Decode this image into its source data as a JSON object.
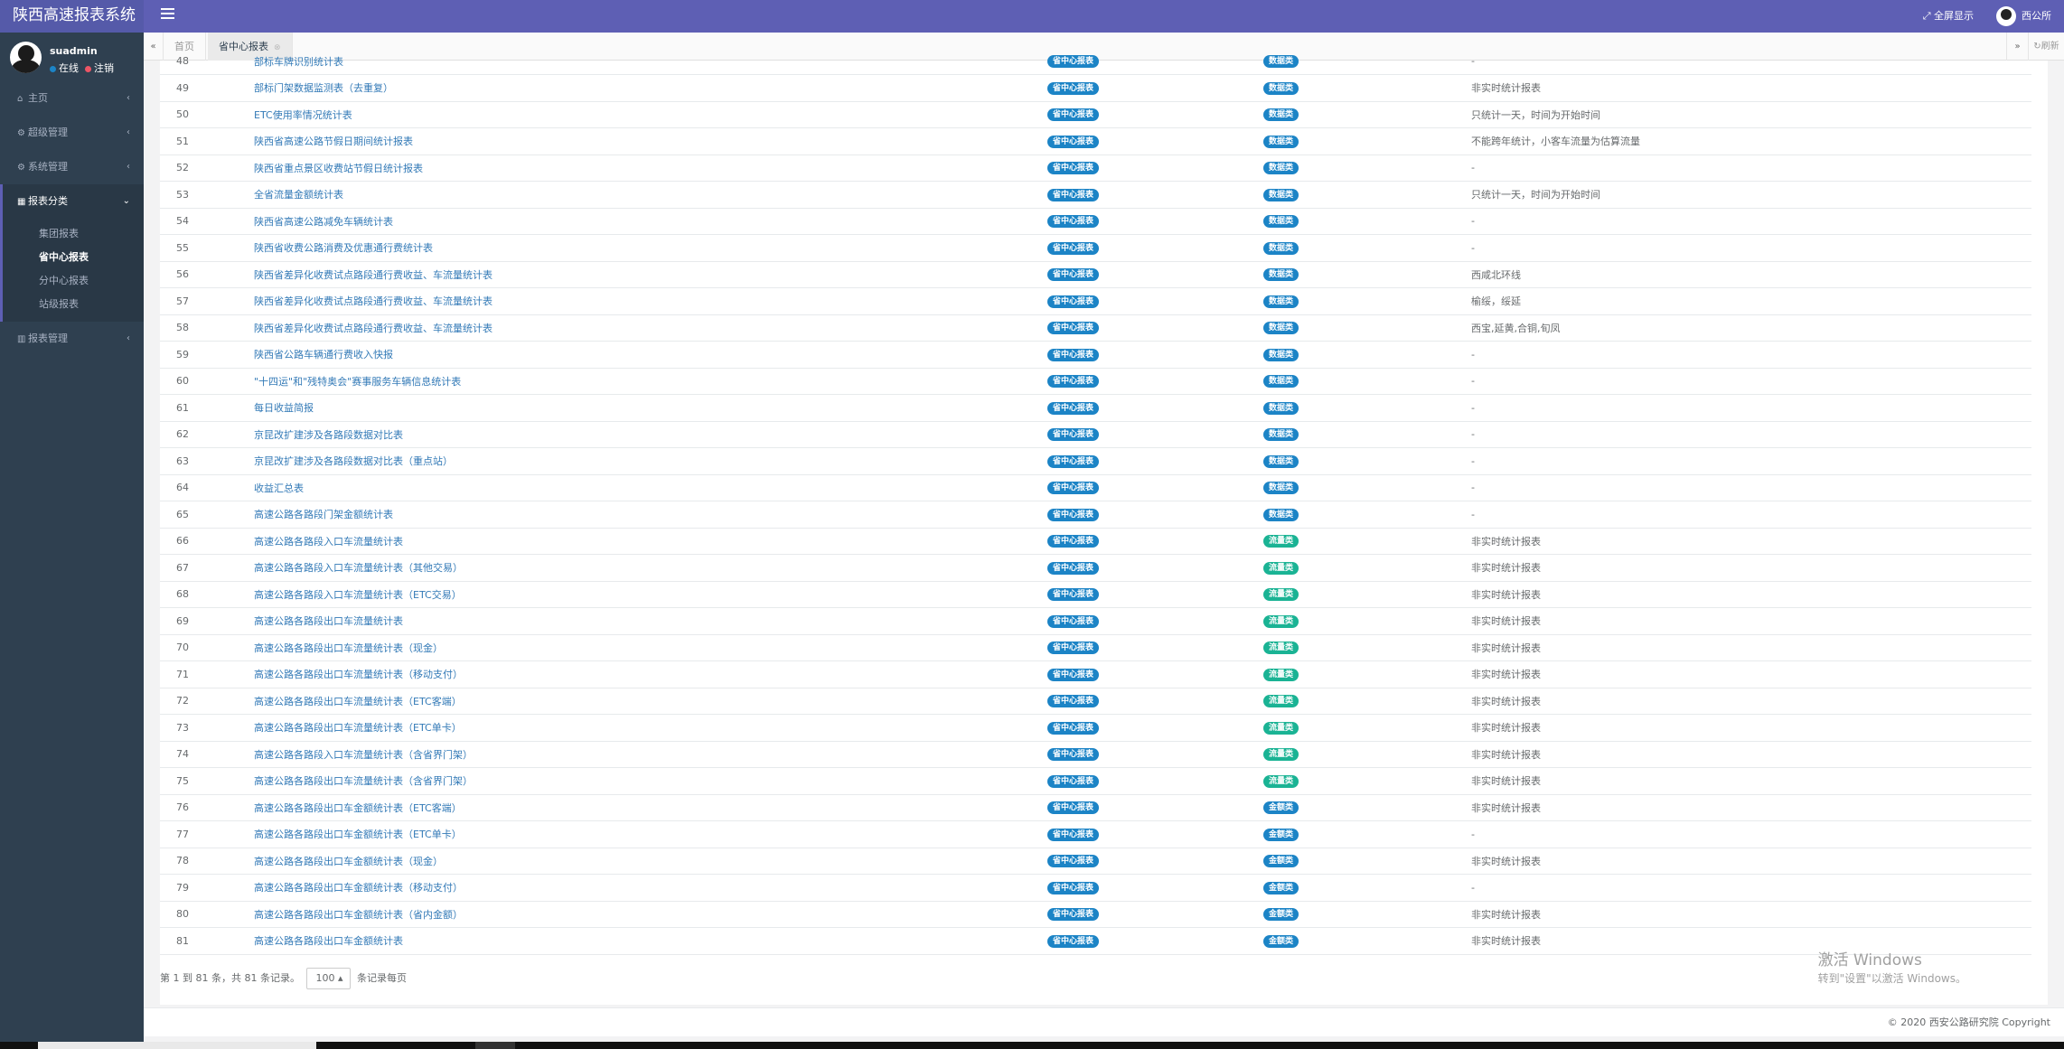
{
  "app": {
    "title": "陕西高速报表系统",
    "fullscreen_label": "全屏显示",
    "user_name": "西公所"
  },
  "sidebar": {
    "username": "suadmin",
    "status_online": "在线",
    "status_logout": "注销",
    "items": [
      {
        "icon": "home-icon",
        "label": "主页"
      },
      {
        "icon": "gear-icon",
        "label": "超级管理"
      },
      {
        "icon": "gear-icon",
        "label": "系统管理"
      },
      {
        "icon": "calendar-icon",
        "label": "报表分类"
      },
      {
        "icon": "bar-chart-icon",
        "label": "报表管理"
      }
    ],
    "submenu": [
      "集团报表",
      "省中心报表",
      "分中心报表",
      "站级报表"
    ]
  },
  "tabs": {
    "home": "首页",
    "active": "省中心报表",
    "refresh": "刷新"
  },
  "colors": {
    "top_bar": "#5e5fb4",
    "badge_blue": "#1c84c6",
    "badge_green": "#1ab394"
  },
  "table": {
    "rows": [
      {
        "no": "48",
        "name": "部标车牌识别统计表",
        "src": "省中心报表",
        "cat": "数据类",
        "note": "-"
      },
      {
        "no": "49",
        "name": "部标门架数据监测表（去重复）",
        "src": "省中心报表",
        "cat": "数据类",
        "note": "非实时统计报表"
      },
      {
        "no": "50",
        "name": "ETC使用率情况统计表",
        "src": "省中心报表",
        "cat": "数据类",
        "note": "只统计一天，时间为开始时间"
      },
      {
        "no": "51",
        "name": "陕西省高速公路节假日期间统计报表",
        "src": "省中心报表",
        "cat": "数据类",
        "note": "不能跨年统计，小客车流量为估算流量"
      },
      {
        "no": "52",
        "name": "陕西省重点景区收费站节假日统计报表",
        "src": "省中心报表",
        "cat": "数据类",
        "note": "-"
      },
      {
        "no": "53",
        "name": "全省流量金额统计表",
        "src": "省中心报表",
        "cat": "数据类",
        "note": "只统计一天，时间为开始时间"
      },
      {
        "no": "54",
        "name": "陕西省高速公路减免车辆统计表",
        "src": "省中心报表",
        "cat": "数据类",
        "note": "-"
      },
      {
        "no": "55",
        "name": "陕西省收费公路消费及优惠通行费统计表",
        "src": "省中心报表",
        "cat": "数据类",
        "note": "-"
      },
      {
        "no": "56",
        "name": "陕西省差异化收费试点路段通行费收益、车流量统计表",
        "src": "省中心报表",
        "cat": "数据类",
        "note": "西咸北环线"
      },
      {
        "no": "57",
        "name": "陕西省差异化收费试点路段通行费收益、车流量统计表",
        "src": "省中心报表",
        "cat": "数据类",
        "note": "榆绥，绥延"
      },
      {
        "no": "58",
        "name": "陕西省差异化收费试点路段通行费收益、车流量统计表",
        "src": "省中心报表",
        "cat": "数据类",
        "note": "西宝,延黄,合铜,旬凤"
      },
      {
        "no": "59",
        "name": "陕西省公路车辆通行费收入快报",
        "src": "省中心报表",
        "cat": "数据类",
        "note": "-"
      },
      {
        "no": "60",
        "name": "\"十四运\"和\"残特奥会\"赛事服务车辆信息统计表",
        "src": "省中心报表",
        "cat": "数据类",
        "note": "-"
      },
      {
        "no": "61",
        "name": "每日收益简报",
        "src": "省中心报表",
        "cat": "数据类",
        "note": "-"
      },
      {
        "no": "62",
        "name": "京昆改扩建涉及各路段数据对比表",
        "src": "省中心报表",
        "cat": "数据类",
        "note": "-"
      },
      {
        "no": "63",
        "name": "京昆改扩建涉及各路段数据对比表（重点站）",
        "src": "省中心报表",
        "cat": "数据类",
        "note": "-"
      },
      {
        "no": "64",
        "name": "收益汇总表",
        "src": "省中心报表",
        "cat": "数据类",
        "note": "-"
      },
      {
        "no": "65",
        "name": "高速公路各路段门架金额统计表",
        "src": "省中心报表",
        "cat": "数据类",
        "note": "-"
      },
      {
        "no": "66",
        "name": "高速公路各路段入口车流量统计表",
        "src": "省中心报表",
        "cat": "流量类",
        "note": "非实时统计报表"
      },
      {
        "no": "67",
        "name": "高速公路各路段入口车流量统计表（其他交易）",
        "src": "省中心报表",
        "cat": "流量类",
        "note": "非实时统计报表"
      },
      {
        "no": "68",
        "name": "高速公路各路段入口车流量统计表（ETC交易）",
        "src": "省中心报表",
        "cat": "流量类",
        "note": "非实时统计报表"
      },
      {
        "no": "69",
        "name": "高速公路各路段出口车流量统计表",
        "src": "省中心报表",
        "cat": "流量类",
        "note": "非实时统计报表"
      },
      {
        "no": "70",
        "name": "高速公路各路段出口车流量统计表（现金）",
        "src": "省中心报表",
        "cat": "流量类",
        "note": "非实时统计报表"
      },
      {
        "no": "71",
        "name": "高速公路各路段出口车流量统计表（移动支付）",
        "src": "省中心报表",
        "cat": "流量类",
        "note": "非实时统计报表"
      },
      {
        "no": "72",
        "name": "高速公路各路段出口车流量统计表（ETC客端）",
        "src": "省中心报表",
        "cat": "流量类",
        "note": "非实时统计报表"
      },
      {
        "no": "73",
        "name": "高速公路各路段出口车流量统计表（ETC单卡）",
        "src": "省中心报表",
        "cat": "流量类",
        "note": "非实时统计报表"
      },
      {
        "no": "74",
        "name": "高速公路各路段入口车流量统计表（含省界门架）",
        "src": "省中心报表",
        "cat": "流量类",
        "note": "非实时统计报表"
      },
      {
        "no": "75",
        "name": "高速公路各路段出口车流量统计表（含省界门架）",
        "src": "省中心报表",
        "cat": "流量类",
        "note": "非实时统计报表"
      },
      {
        "no": "76",
        "name": "高速公路各路段出口车金额统计表（ETC客端）",
        "src": "省中心报表",
        "cat": "金额类",
        "note": "非实时统计报表"
      },
      {
        "no": "77",
        "name": "高速公路各路段出口车金额统计表（ETC单卡）",
        "src": "省中心报表",
        "cat": "金额类",
        "note": "-"
      },
      {
        "no": "78",
        "name": "高速公路各路段出口车金额统计表（现金）",
        "src": "省中心报表",
        "cat": "金额类",
        "note": "非实时统计报表"
      },
      {
        "no": "79",
        "name": "高速公路各路段出口车金额统计表（移动支付）",
        "src": "省中心报表",
        "cat": "金额类",
        "note": "-"
      },
      {
        "no": "80",
        "name": "高速公路各路段出口车金额统计表（省内金额）",
        "src": "省中心报表",
        "cat": "金额类",
        "note": "非实时统计报表"
      },
      {
        "no": "81",
        "name": "高速公路各路段出口车金额统计表",
        "src": "省中心报表",
        "cat": "金额类",
        "note": "非实时统计报表"
      }
    ]
  },
  "pagination": {
    "summary": "第 1 到 81 条，共 81 条记录。",
    "page_size": "100",
    "per_page_label": "条记录每页"
  },
  "watermark": {
    "line1": "激活 Windows",
    "line2": "转到\"设置\"以激活 Windows。"
  },
  "footer": {
    "copyright": "© 2020 西安公路研究院 Copyright"
  }
}
